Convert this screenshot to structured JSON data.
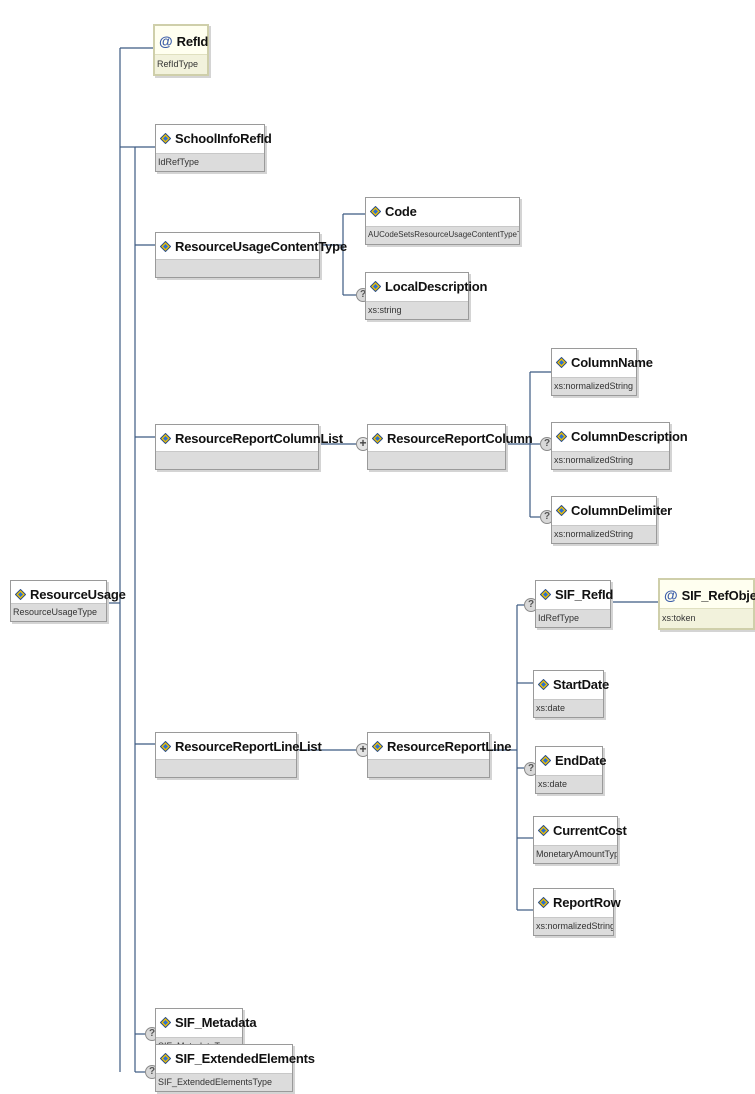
{
  "colors": {
    "line": "#3c5a82",
    "border": "#9a9a9a",
    "type_band": "#dcdcdc"
  },
  "root": {
    "name": "ResourceUsage",
    "type": "ResourceUsageType"
  },
  "nodes": {
    "refid": {
      "name": "RefId",
      "type": "RefIdType"
    },
    "schoolinforefid": {
      "name": "SchoolInfoRefId",
      "type": "IdRefType"
    },
    "content_type": {
      "name": "ResourceUsageContentType"
    },
    "code": {
      "name": "Code",
      "type": "AUCodeSetsResourceUsageContentTypeType"
    },
    "localdesc": {
      "name": "LocalDescription",
      "type": "xs:string"
    },
    "col_list": {
      "name": "ResourceReportColumnList"
    },
    "col": {
      "name": "ResourceReportColumn"
    },
    "colname": {
      "name": "ColumnName",
      "type": "xs:normalizedString"
    },
    "coldesc": {
      "name": "ColumnDescription",
      "type": "xs:normalizedString"
    },
    "coldelim": {
      "name": "ColumnDelimiter",
      "type": "xs:normalizedString"
    },
    "line_list": {
      "name": "ResourceReportLineList"
    },
    "line": {
      "name": "ResourceReportLine"
    },
    "sif_refid": {
      "name": "SIF_RefId",
      "type": "IdRefType"
    },
    "sif_refobject": {
      "name": "SIF_RefObject",
      "type": "xs:token"
    },
    "startdate": {
      "name": "StartDate",
      "type": "xs:date"
    },
    "enddate": {
      "name": "EndDate",
      "type": "xs:date"
    },
    "currentcost": {
      "name": "CurrentCost",
      "type": "MonetaryAmountType"
    },
    "reportrow": {
      "name": "ReportRow",
      "type": "xs:normalizedString"
    },
    "metadata": {
      "name": "SIF_Metadata",
      "type": "SIF_MetadataType"
    },
    "extended": {
      "name": "SIF_ExtendedElements",
      "type": "SIF_ExtendedElementsType"
    }
  },
  "symbols": {
    "optional": "?",
    "repeating": "+",
    "attribute": "@"
  }
}
